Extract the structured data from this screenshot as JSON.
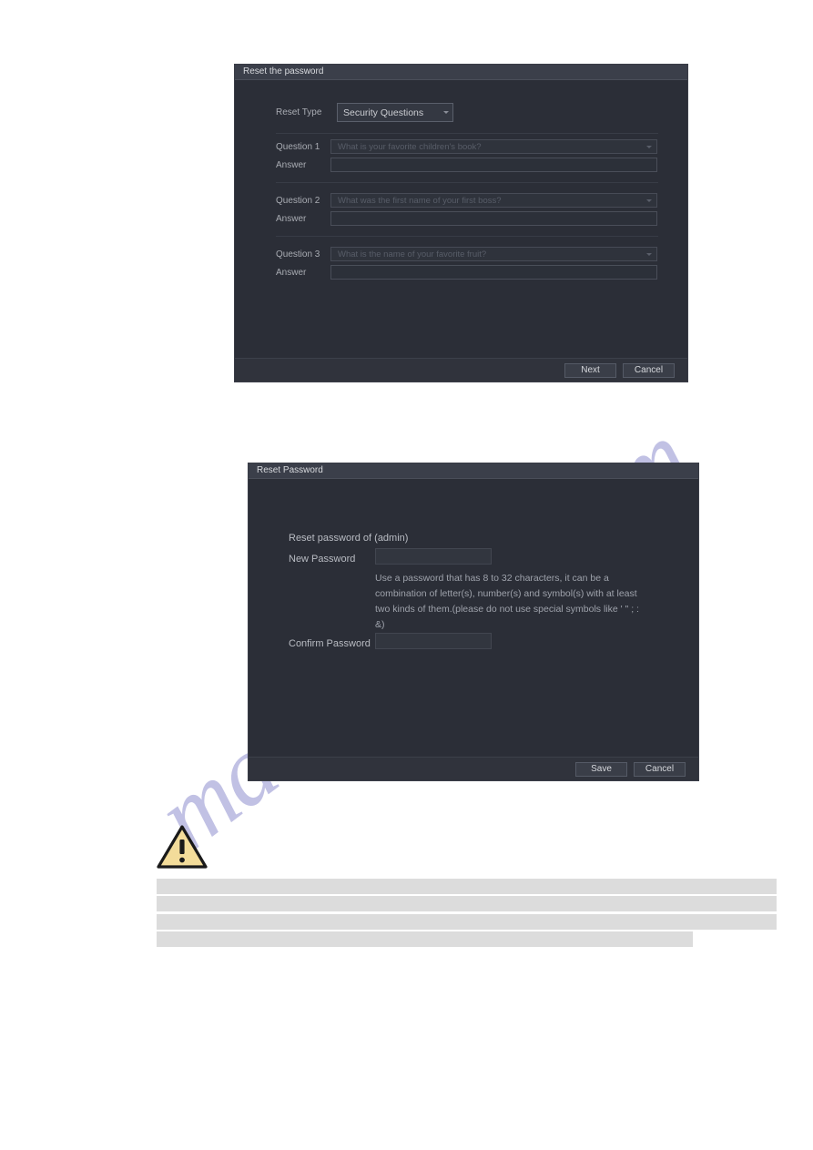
{
  "page": {
    "watermark_text": "manualsave.com"
  },
  "dialog_security_questions": {
    "title": "Reset the password",
    "reset_type_label": "Reset Type",
    "reset_type_value": "Security Questions",
    "questions": [
      {
        "label": "Question 1",
        "question": "What is your favorite children's book?",
        "answer_label": "Answer",
        "answer_value": ""
      },
      {
        "label": "Question 2",
        "question": "What was the first name of your first boss?",
        "answer_label": "Answer",
        "answer_value": ""
      },
      {
        "label": "Question 3",
        "question": "What is the name of your favorite fruit?",
        "answer_label": "Answer",
        "answer_value": ""
      }
    ],
    "next_button": "Next",
    "cancel_button": "Cancel"
  },
  "dialog_reset_password": {
    "title": "Reset Password",
    "subject_label": "Reset password of (admin)",
    "new_password_label": "New Password",
    "new_password_value": "",
    "hint_line_1": "Use a password that has 8 to 32 characters, it can be a",
    "hint_line_2": "combination of letter(s), number(s) and symbol(s) with at least",
    "hint_line_3": "two kinds of them.(please do not use special symbols like ' \" ; : &)",
    "confirm_password_label": "Confirm Password",
    "confirm_password_value": "",
    "save_button": "Save",
    "cancel_button": "Cancel"
  },
  "notice": {
    "icon": "warning-triangle-icon",
    "redacted_lines": [
      "",
      "",
      "",
      ""
    ]
  },
  "colors": {
    "dialog_bg": "#2b2e37",
    "titlebar_bg": "#3b3f4a",
    "accent_text": "#d8dade",
    "warning_fill": "#f5dd97",
    "redacted_bar": "#dcdcdc"
  }
}
